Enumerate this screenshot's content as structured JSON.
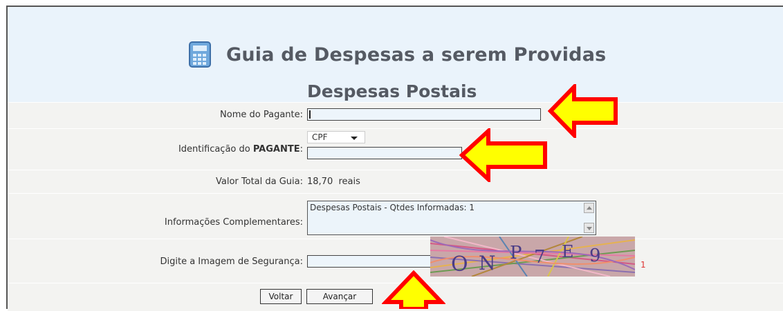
{
  "header": {
    "title": "Guia de Despesas a serem Providas",
    "subtitle": "Despesas Postais",
    "icon": "calculator-icon"
  },
  "form": {
    "nome_label": "Nome do Pagante:",
    "nome_value": "",
    "ident_label_prefix": "Identificação do ",
    "ident_label_bold": "PAGANTE",
    "ident_label_suffix": ":",
    "ident_type_selected": "CPF",
    "ident_value": "",
    "valor_label": "Valor Total da Guia:",
    "valor_value": "18,70",
    "valor_unit": "reais",
    "info_label": "Informações Complementares:",
    "info_value": "Despesas Postais - Qtdes Informadas: 1",
    "captcha_label": "Digite a Imagem de Segurança:",
    "captcha_value": "",
    "captcha_text": "ONP7E9",
    "captcha_extra": "1"
  },
  "buttons": {
    "voltar": "Voltar",
    "avancar": "Avançar"
  },
  "colors": {
    "arrow_fill": "#ffff00",
    "arrow_stroke": "#ff0000",
    "title": "#555a63"
  }
}
